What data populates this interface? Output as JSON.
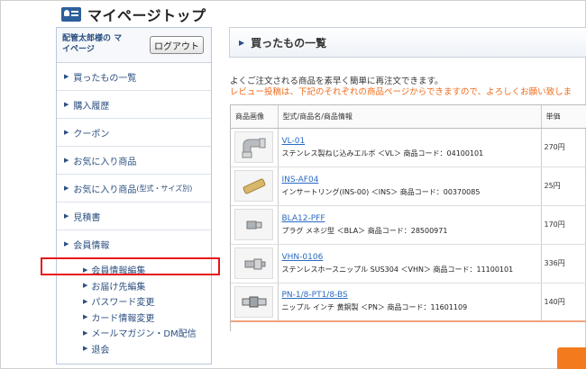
{
  "header": {
    "title": "マイページトップ",
    "icon": "member-card-icon"
  },
  "sidebar": {
    "user_name": "配管太郎様の マイページ",
    "logout_label": "ログアウト",
    "items": [
      {
        "label": "買ったもの一覧"
      },
      {
        "label": "購入履歴"
      },
      {
        "label": "クーポン"
      },
      {
        "label": "お気に入り商品"
      },
      {
        "label": "お気に入り商品",
        "suffix": "(型式・サイズ別)"
      },
      {
        "label": "見積書"
      },
      {
        "label": "会員情報"
      }
    ],
    "subitems": [
      {
        "label": "会員情報編集"
      },
      {
        "label": "お届け先編集"
      },
      {
        "label": "パスワード変更"
      },
      {
        "label": "カード情報変更"
      },
      {
        "label": "メールマガジン・DM配信"
      },
      {
        "label": "退会"
      }
    ]
  },
  "main": {
    "title": "買ったもの一覧",
    "desc1": "よくご注文される商品を素早く簡単に再注文できます。",
    "desc2": "レビュー投稿は、下記のそれぞれの商品ページからできますので、よろしくお願い致しま",
    "table": {
      "headers": [
        "商品画像",
        "型式/商品名/商品情報",
        "単価"
      ],
      "rows": [
        {
          "code": "VL-01",
          "desc": "ステンレス製ねじ込みエルボ ＜VL＞ 商品コード：04100101",
          "price": "270円",
          "img": "elbow-fitting-icon"
        },
        {
          "code": "INS-AF04",
          "desc": "インサートリング(INS-00) ＜INS＞ 商品コード：00370085",
          "price": "25円",
          "img": "insert-ring-icon"
        },
        {
          "code": "BLA12-PFF",
          "desc": "プラグ メネジ型 ＜BLA＞ 商品コード：28500971",
          "price": "170円",
          "img": "plug-icon"
        },
        {
          "code": "VHN-0106",
          "desc": "ステンレスホースニップル SUS304 ＜VHN＞ 商品コード：11100101",
          "price": "336円",
          "img": "hose-nipple-icon"
        },
        {
          "code": "PN-1/8-PT1/8-BS",
          "desc": "ニップル インチ 黄銅製 ＜PN＞ 商品コード：11601109",
          "price": "140円",
          "img": "nipple-icon"
        }
      ]
    }
  },
  "colors": {
    "highlight": "#e8141a",
    "link": "#2a6bc2",
    "notice": "#f06b1b",
    "accent": "#f47a1e"
  }
}
